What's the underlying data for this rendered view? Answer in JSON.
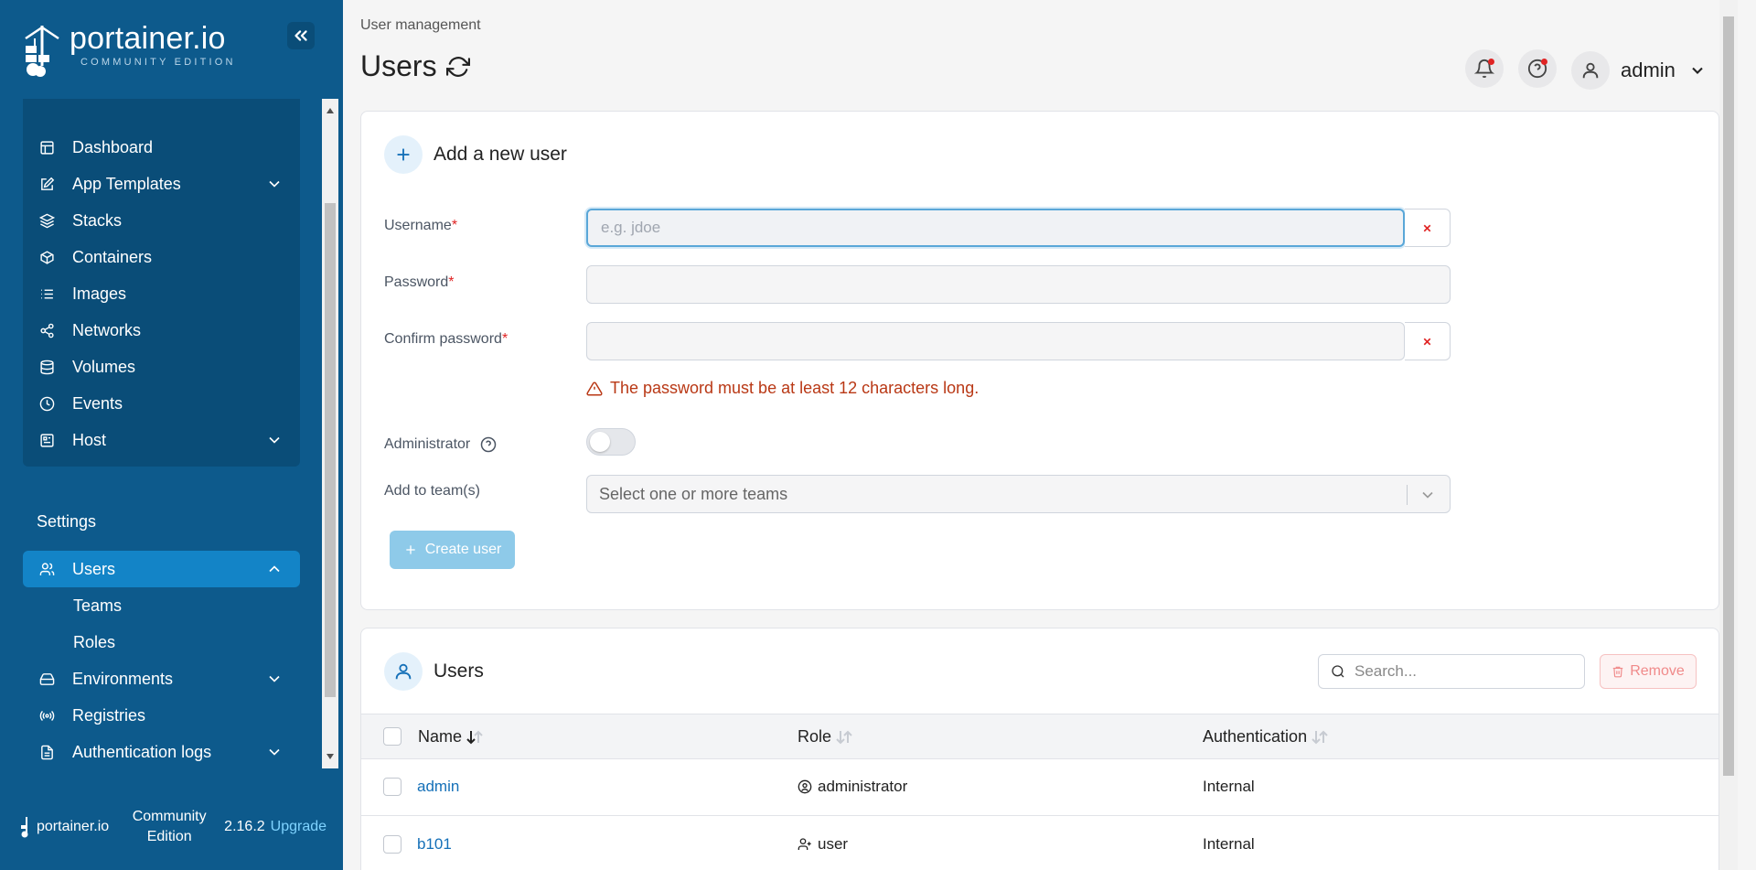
{
  "sidebar": {
    "logo_text": "portainer.io",
    "logo_sub": "COMMUNITY EDITION",
    "env_items": [
      {
        "label": "Dashboard",
        "icon": "dashboard-icon"
      },
      {
        "label": "App Templates",
        "icon": "edit-icon",
        "expandable": true
      },
      {
        "label": "Stacks",
        "icon": "layers-icon"
      },
      {
        "label": "Containers",
        "icon": "box-icon"
      },
      {
        "label": "Images",
        "icon": "list-icon"
      },
      {
        "label": "Networks",
        "icon": "share-icon"
      },
      {
        "label": "Volumes",
        "icon": "database-icon"
      },
      {
        "label": "Events",
        "icon": "clock-icon"
      },
      {
        "label": "Host",
        "icon": "grid-icon",
        "expandable": true
      }
    ],
    "settings_label": "Settings",
    "users_label": "Users",
    "teams_label": "Teams",
    "roles_label": "Roles",
    "environments_label": "Environments",
    "registries_label": "Registries",
    "auth_logs_label": "Authentication logs",
    "footer": {
      "logo_text": "portainer.io",
      "edition_line1": "Community",
      "edition_line2": "Edition",
      "version": "2.16.2",
      "upgrade": "Upgrade"
    }
  },
  "header": {
    "breadcrumb": "User management",
    "title": "Users",
    "user_name": "admin"
  },
  "add_user": {
    "title": "Add a new user",
    "username_label": "Username",
    "username_placeholder": "e.g. jdoe",
    "password_label": "Password",
    "confirm_label": "Confirm password",
    "required_mark": "*",
    "warning": "The password must be at least 12 characters long.",
    "admin_label": "Administrator",
    "admin_enabled": false,
    "teams_label": "Add to team(s)",
    "teams_placeholder": "Select one or more teams",
    "create_button": "Create user"
  },
  "users_table": {
    "title": "Users",
    "search_placeholder": "Search...",
    "remove_button": "Remove",
    "columns": [
      "Name",
      "Role",
      "Authentication"
    ],
    "rows": [
      {
        "name": "admin",
        "role": "administrator",
        "role_icon": "user-circle-icon",
        "auth": "Internal"
      },
      {
        "name": "b101",
        "role": "user",
        "role_icon": "user-plus-icon",
        "auth": "Internal"
      }
    ]
  },
  "colors": {
    "sidebar_bg": "#0d5a8c",
    "sidebar_group_bg": "#0a4d78",
    "active_item": "#1384c7",
    "link": "#1570b8",
    "warning": "#b93815",
    "danger": "#e02424"
  }
}
